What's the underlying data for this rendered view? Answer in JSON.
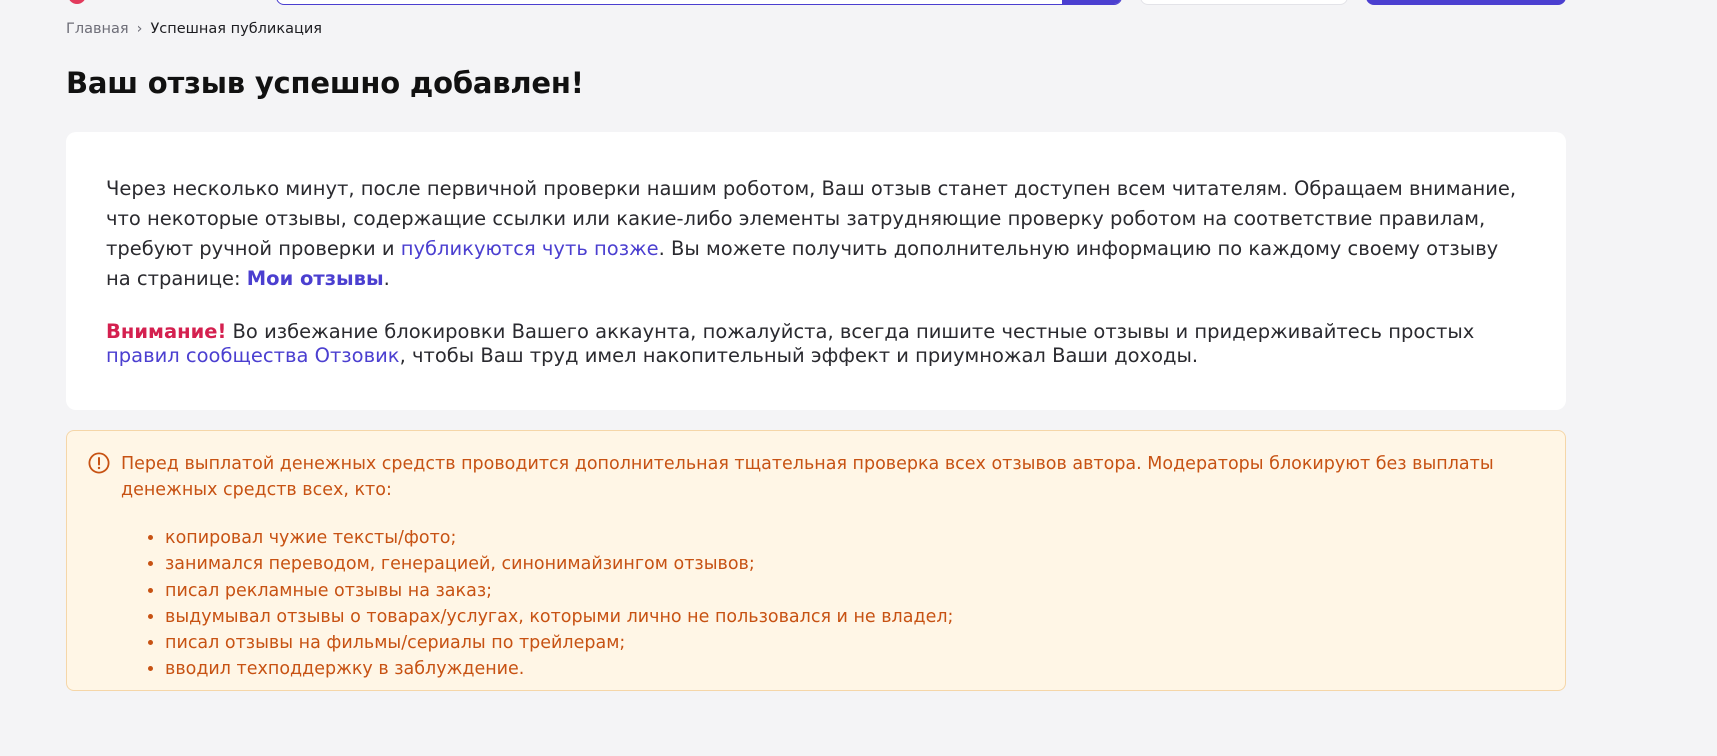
{
  "breadcrumb": {
    "home": "Главная",
    "separator": "›",
    "current": "Успешная публикация"
  },
  "page": {
    "title": "Ваш отзыв успешно добавлен!"
  },
  "info": {
    "p1_text_a": "Через несколько минут, после первичной проверки нашим роботом, Ваш отзыв станет доступен всем читателям. Обращаем внимание, что некоторые отзывы, содержащие ссылки или какие-либо элементы затрудняющие проверку роботом на соответствие правилам, требуют ручной проверки и ",
    "p1_link": "публикуются чуть позже",
    "p1_text_b": ". Вы можете получить дополнительную информацию по каждому своему отзыву на странице: ",
    "my_reviews_link": "Мои отзывы",
    "p1_end": ".",
    "attention_label": "Внимание!",
    "p2_text_a": " Во избежание блокировки Вашего аккаунта, пожалуйста, всегда пишите честные отзывы и придерживайтесь простых ",
    "rules_link": "правил сообщества Отзовик",
    "p2_text_b": ", чтобы Ваш труд имел накопительный эффект и приумножал Ваши доходы."
  },
  "warning": {
    "icon": "exclamation-circle-icon",
    "text": "Перед выплатой денежных средств проводится дополнительная тщательная проверка всех отзывов автора. Модераторы блокируют без выплаты денежных средств всех, кто:",
    "items": [
      "копировал чужие тексты/фото;",
      "занимался переводом, генерацией, синонимайзингом отзывов;",
      "писал рекламные отзывы на заказ;",
      "выдумывал отзывы о товарах/услугах, которыми лично не пользовался и не владел;",
      "писал отзывы на фильмы/сериалы по трейлерам;",
      "вводил техподдержку в заблуждение."
    ]
  },
  "colors": {
    "accent": "#4b3fd0",
    "attention": "#d4204f",
    "warning_text": "#c75213",
    "warning_bg": "#fff6e6"
  }
}
